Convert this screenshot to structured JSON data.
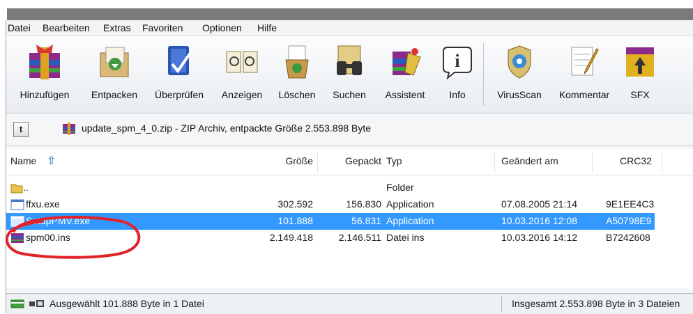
{
  "menu": [
    "Datei",
    "Bearbeiten",
    "Extras",
    "Favoriten",
    "Optionen",
    "Hilfe"
  ],
  "toolbar": [
    {
      "label": "Hinzufügen",
      "icon": "add-archive-icon"
    },
    {
      "label": "Entpacken",
      "icon": "extract-icon"
    },
    {
      "label": "Überprüfen",
      "icon": "test-icon"
    },
    {
      "label": "Anzeigen",
      "icon": "view-icon"
    },
    {
      "label": "Löschen",
      "icon": "delete-icon"
    },
    {
      "label": "Suchen",
      "icon": "find-icon"
    },
    {
      "label": "Assistent",
      "icon": "wizard-icon"
    },
    {
      "label": "Info",
      "icon": "info-icon"
    },
    {
      "label": "VirusScan",
      "icon": "virusscan-icon"
    },
    {
      "label": "Kommentar",
      "icon": "comment-icon"
    },
    {
      "label": "SFX",
      "icon": "sfx-icon"
    }
  ],
  "path": {
    "up_label": "t",
    "text": "update_spm_4_0.zip - ZIP Archiv, entpackte Größe 2.553.898 Byte"
  },
  "columns": [
    "Name",
    "Größe",
    "Gepackt",
    "Typ",
    "Geändert am",
    "CRC32"
  ],
  "files": [
    {
      "name": "..",
      "size": "",
      "packed": "",
      "type": "Folder",
      "modified": "",
      "crc": "",
      "icon": "folder-icon"
    },
    {
      "name": "ffxu.exe",
      "size": "302.592",
      "packed": "156.830",
      "type": "Application",
      "modified": "07.08.2005 21:14",
      "crc": "9E1EE4C3",
      "icon": "exe-icon"
    },
    {
      "name": "SetupPMV.exe",
      "size": "101.888",
      "packed": "56.831",
      "type": "Application",
      "modified": "10.03.2016 12:08",
      "crc": "A50798E9",
      "icon": "exe-icon"
    },
    {
      "name": "spm00.ins",
      "size": "2.149.418",
      "packed": "2.146.511",
      "type": "Datei ins",
      "modified": "10.03.2016 14:12",
      "crc": "B7242608",
      "icon": "archive-file-icon"
    }
  ],
  "status": {
    "left": "Ausgewählt 101.888 Byte in 1 Datei",
    "right": "Insgesamt 2.553.898 Byte in 3 Dateien"
  },
  "colors": {
    "selection": "#3399ff",
    "annotation": "#e0242a"
  }
}
